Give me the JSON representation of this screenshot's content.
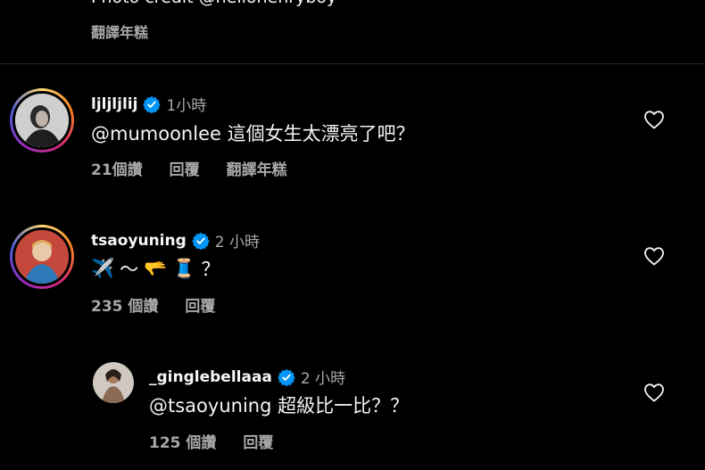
{
  "top": {
    "caption": "Photo credit @hellohenryboy",
    "translate": "翻譯年糕"
  },
  "comments": [
    {
      "username": "ljljljlij",
      "time": "1小時",
      "text": "@mumoonlee 這個女生太漂亮了吧？",
      "likes": "21個讚",
      "reply": "回覆",
      "translate": "翻譯年糕"
    },
    {
      "username": "tsaoyuning",
      "time": "2 小時",
      "text_tail": "？",
      "emoji": [
        "✈️",
        "〜",
        "🫳",
        "🧵"
      ],
      "likes": "235 個讚",
      "reply": "回覆"
    },
    {
      "username": "_ginglebellaaa",
      "time": "2 小時",
      "text": "@tsaoyuning 超級比一比？？",
      "likes": "125 個讚",
      "reply": "回覆"
    }
  ],
  "colors": {
    "background": "#000000",
    "text_primary": "#f5f5f5",
    "text_secondary": "#a8a8a8",
    "verified": "#0095f6"
  }
}
